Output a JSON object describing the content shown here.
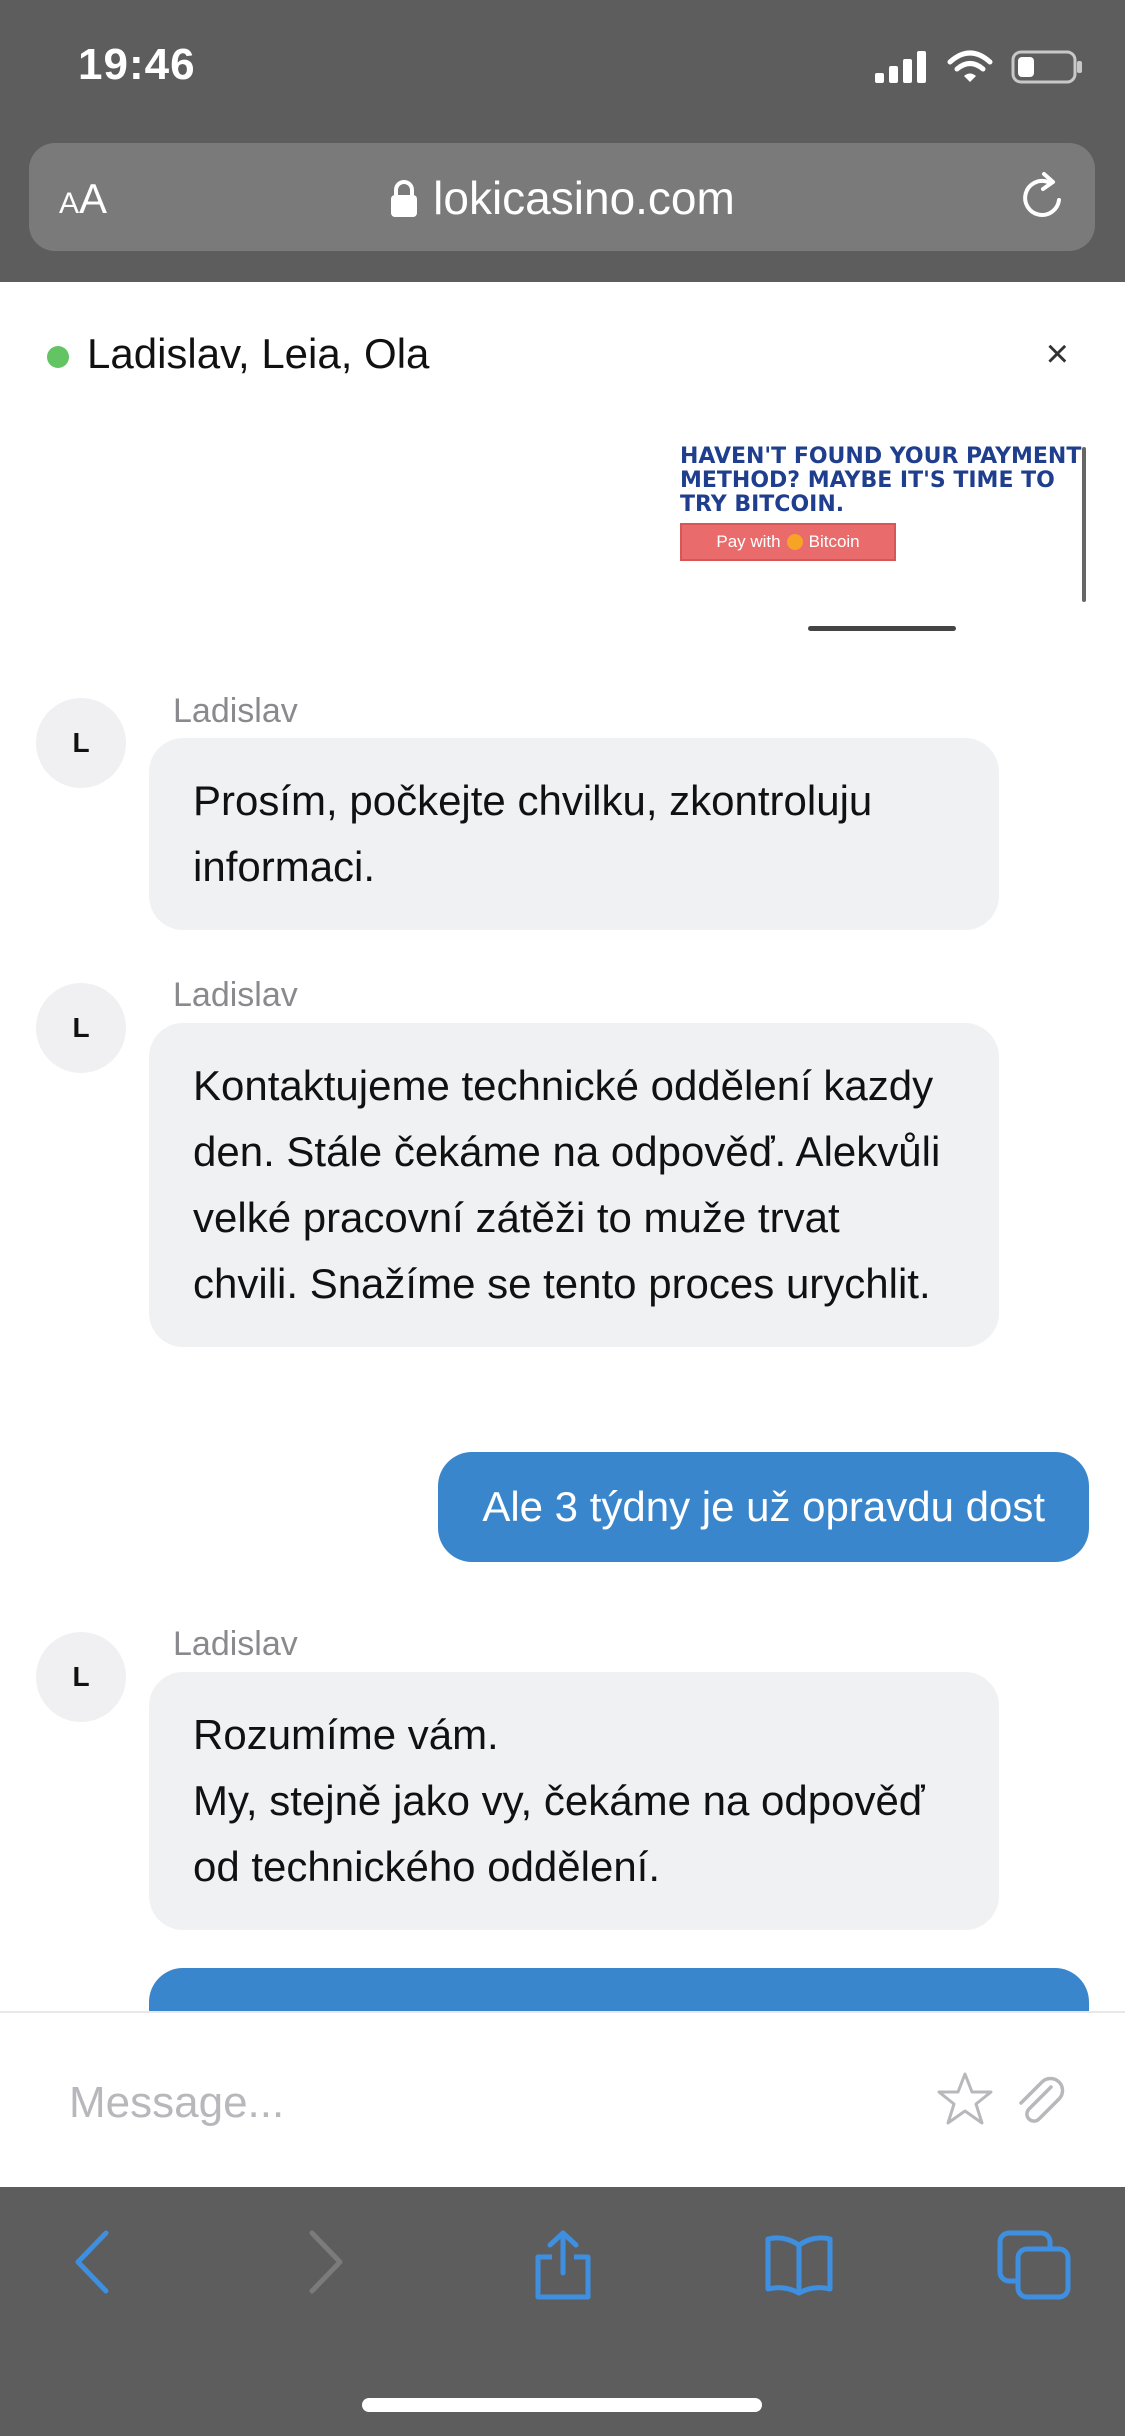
{
  "status_bar": {
    "time": "19:46"
  },
  "browser": {
    "text_size_label_small": "A",
    "text_size_label_large": "A",
    "url": "lokicasino.com"
  },
  "chat": {
    "participants": "Ladislav, Leia, Ola",
    "close_label": "×",
    "banner": {
      "headline": "HAVEN'T FOUND YOUR PAYMENT METHOD? MAYBE IT'S TIME TO TRY BITCOIN.",
      "button_prefix": "Pay with",
      "button_coin": "Bitcoin"
    },
    "messages": [
      {
        "avatar": "L",
        "sender": "Ladislav",
        "text": "Prosím, počkejte chvilku, zkontroluju informaci."
      },
      {
        "avatar": "L",
        "sender": "Ladislav",
        "text": "Kontaktujeme technické oddělení kazdy den. Stále čekáme na odpověď. Alekvůli velké pracovní zátěži to muže trvat chvili. Snažíme se tento proces urychlit."
      },
      {
        "own": true,
        "text": "Ale 3 týdny je už opravdu dost"
      },
      {
        "avatar": "L",
        "sender": "Ladislav",
        "text": "Rozumíme vám.\nMy, stejně jako vy, čekáme na odpověď od  technického oddělení."
      }
    ],
    "composer_placeholder": "Message..."
  },
  "colors": {
    "chrome": "#5d5d5d",
    "own_bubble": "#3a86cc",
    "incoming_bubble": "#f0f1f3",
    "online": "#62c462",
    "toolbar_icon": "#3f8fe0"
  }
}
